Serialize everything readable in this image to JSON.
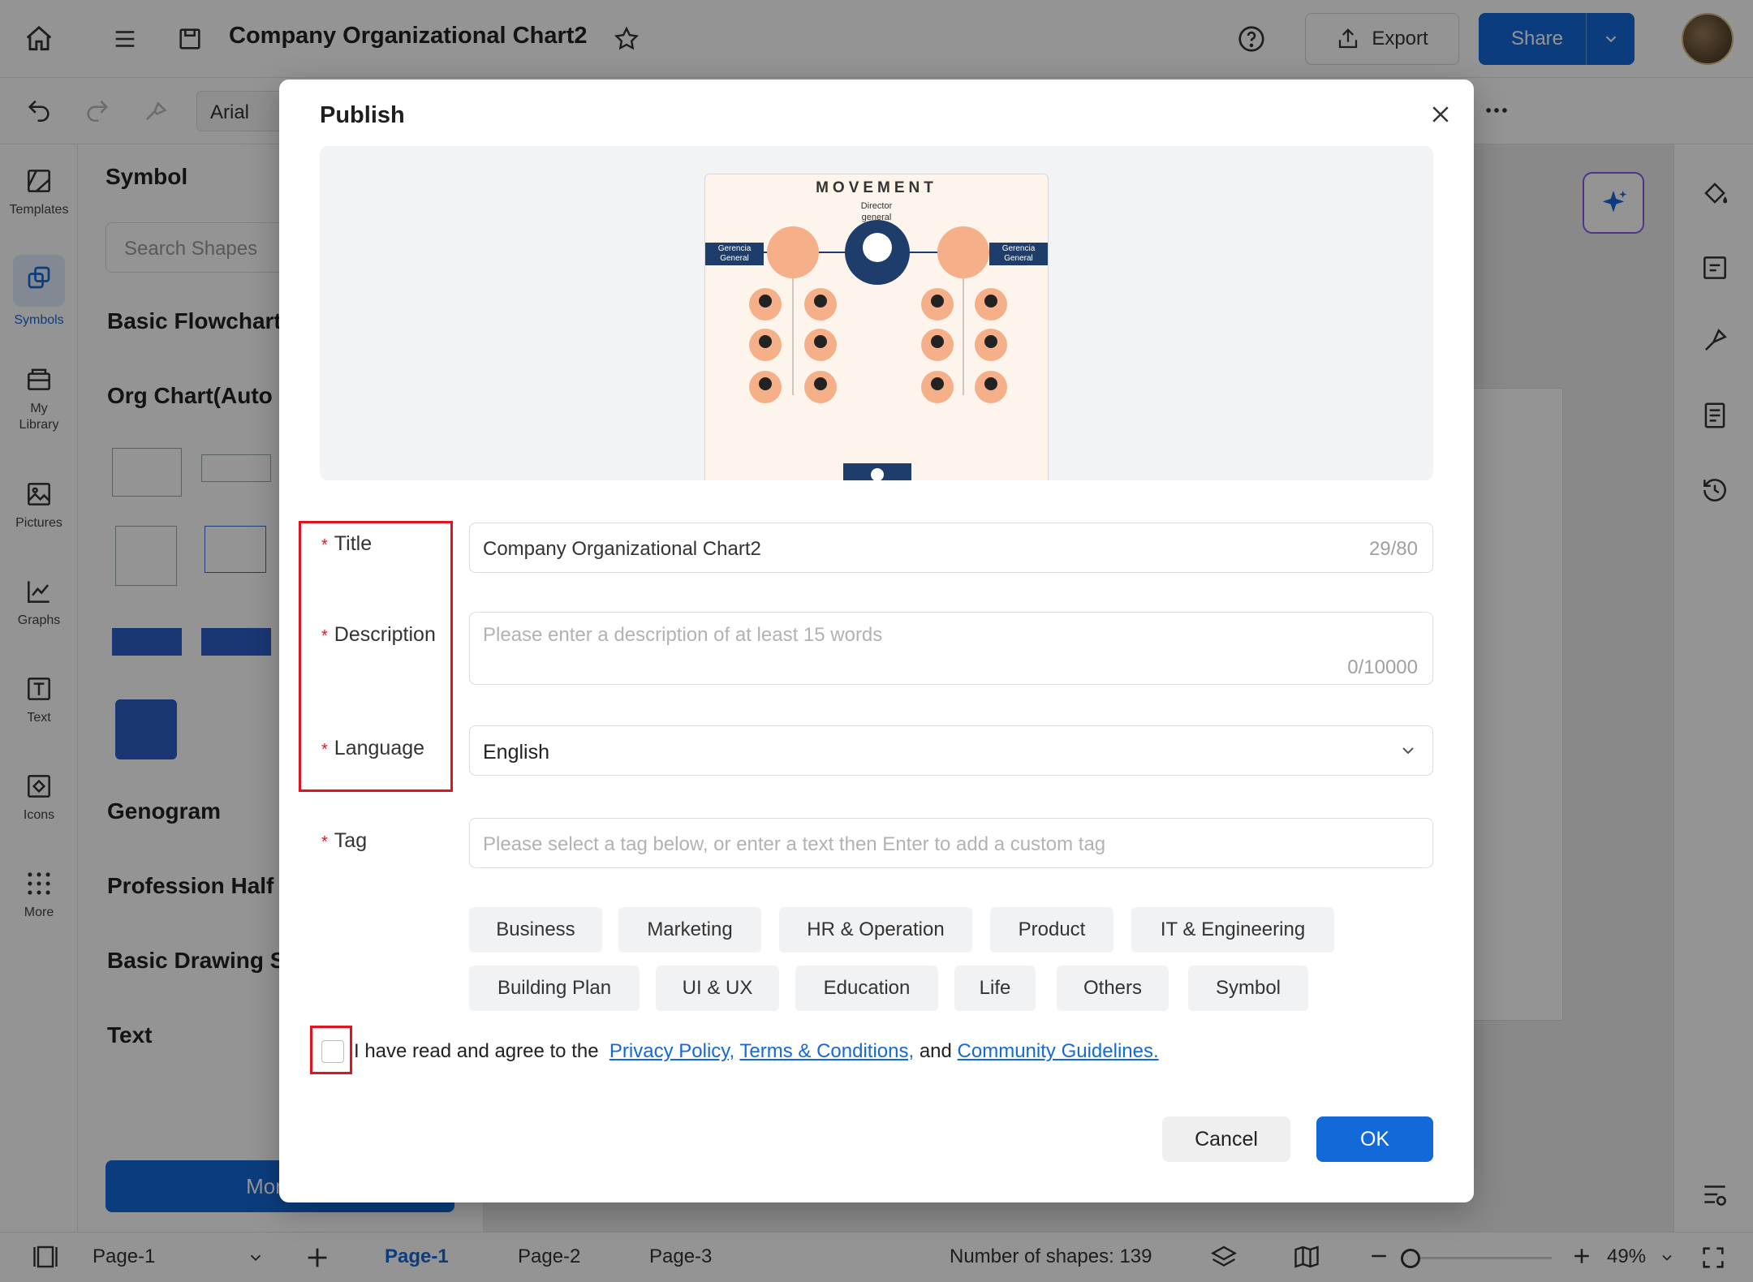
{
  "app": {
    "doc_title": "Company Organizational Chart2",
    "export_label": "Export",
    "share_label": "Share",
    "font_name": "Arial"
  },
  "left_rail": [
    {
      "label": "Templates",
      "icon": "templates-icon"
    },
    {
      "label": "Symbols",
      "icon": "symbols-icon"
    },
    {
      "label": "My Library",
      "icon": "library-icon"
    },
    {
      "label": "Pictures",
      "icon": "pictures-icon"
    },
    {
      "label": "Graphs",
      "icon": "graphs-icon"
    },
    {
      "label": "Text",
      "icon": "text-icon"
    },
    {
      "label": "Icons",
      "icon": "icons-icon"
    },
    {
      "label": "More",
      "icon": "more-icon"
    }
  ],
  "symbol_panel": {
    "title": "Symbol",
    "search_placeholder": "Search Shapes",
    "sections": [
      "Basic Flowchart",
      "Org Chart(Auto",
      "Genogram",
      "Profession Half",
      "Basic Drawing S",
      "Text"
    ],
    "more_button": "More S"
  },
  "bottom_bar": {
    "page_select": "Page-1",
    "tabs": [
      "Page-1",
      "Page-2",
      "Page-3"
    ],
    "shape_count": "Number of shapes: 139",
    "zoom": "49%"
  },
  "dialog": {
    "title": "Publish",
    "preview": {
      "title": "MOVEMENT",
      "subtitle_line1": "Director",
      "subtitle_line2": "general",
      "left_tag": "Gerencia General",
      "right_tag": "Gerencia General"
    },
    "labels": {
      "title": "Title",
      "description": "Description",
      "language": "Language",
      "tag": "Tag"
    },
    "title_value": "Company Organizational Chart2",
    "title_count": "29/80",
    "description_placeholder": "Please enter a description of at least 15 words",
    "description_count": "0/10000",
    "language_value": "English",
    "tag_placeholder": "Please select a tag below, or enter a text then Enter to add a custom tag",
    "tags": [
      "Business",
      "Marketing",
      "HR & Operation",
      "Product",
      "IT & Engineering",
      "Building Plan",
      "UI & UX",
      "Education",
      "Life",
      "Others",
      "Symbol"
    ],
    "agree_text": "I have read and agree to the",
    "links": [
      "Privacy Policy,",
      "Terms & Conditions,",
      "Community Guidelines."
    ],
    "and_text": "and",
    "cancel_label": "Cancel",
    "ok_label": "OK"
  },
  "colors": {
    "accent": "#1469d9",
    "required_star": "#e0141e",
    "highlight_box": "#e0141e"
  }
}
